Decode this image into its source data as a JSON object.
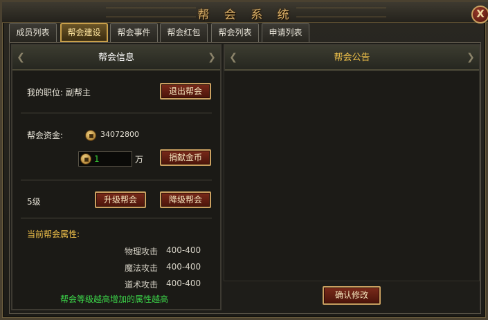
{
  "window": {
    "title": "帮 会 系 统",
    "close_label": "X"
  },
  "tabs": [
    {
      "label": "成员列表",
      "active": false
    },
    {
      "label": "帮会建设",
      "active": true
    },
    {
      "label": "帮会事件",
      "active": false
    },
    {
      "label": "帮会红包",
      "active": false
    },
    {
      "label": "帮会列表",
      "active": false
    },
    {
      "label": "申请列表",
      "active": false
    }
  ],
  "info_panel": {
    "header": "帮会信息",
    "position_label": "我的职位: 副帮主",
    "quit_button": "退出帮会",
    "funds_label": "帮会资金:",
    "funds_value": "34072800",
    "donate_amount": "1",
    "donate_unit": "万",
    "donate_button": "捐献金币",
    "level_label": "5级",
    "upgrade_button": "升级帮会",
    "downgrade_button": "降级帮会",
    "attributes_title": "当前帮会属性:",
    "attributes": [
      {
        "name": "物理攻击",
        "value": "400-400"
      },
      {
        "name": "魔法攻击",
        "value": "400-400"
      },
      {
        "name": "道术攻击",
        "value": "400-400"
      }
    ],
    "hint": "帮会等级越高增加的属性越高"
  },
  "notice_panel": {
    "header": "帮会公告",
    "content": "",
    "confirm_button": "确认修改"
  },
  "colors": {
    "gold_text": "#f1c24a",
    "green_text": "#3cd84a",
    "button_red": "#7a2a1a",
    "button_border": "#caa060"
  }
}
